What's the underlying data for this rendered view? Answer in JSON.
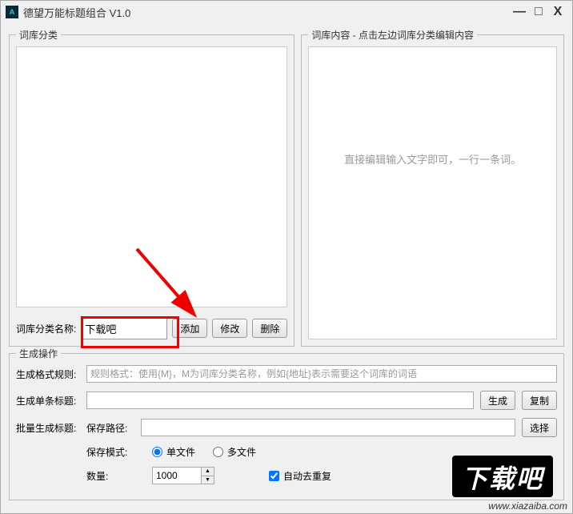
{
  "titlebar": {
    "icon_text": "A",
    "title": "德望万能标题组合  V1.0",
    "min": "—",
    "max": "□",
    "close": "X"
  },
  "category": {
    "legend": "词库分类",
    "name_label": "词库分类名称:",
    "name_value": "下载吧",
    "add": "添加",
    "edit": "修改",
    "delete": "删除"
  },
  "content_panel": {
    "legend": "词库内容 - 点击左边词库分类编辑内容",
    "placeholder": "直接编辑输入文字即可，一行一条词。"
  },
  "generate": {
    "legend": "生成操作",
    "format_label": "生成格式规则:",
    "format_placeholder": "规则格式：使用{M}，M为词库分类名称，例如{地址}表示需要这个词库的词语",
    "single_label": "生成单条标题:",
    "gen_btn": "生成",
    "copy_btn": "复制",
    "batch_label": "批量生成标题:",
    "save_path_label": "保存路径:",
    "choose_btn": "选择",
    "save_mode_label": "保存模式:",
    "mode_single": "单文件",
    "mode_multi": "多文件",
    "qty_label": "数量:",
    "qty_value": "1000",
    "dedup_label": "自动去重复"
  },
  "watermark": {
    "text": "下载吧",
    "url": "www.xiazaiba.com"
  }
}
